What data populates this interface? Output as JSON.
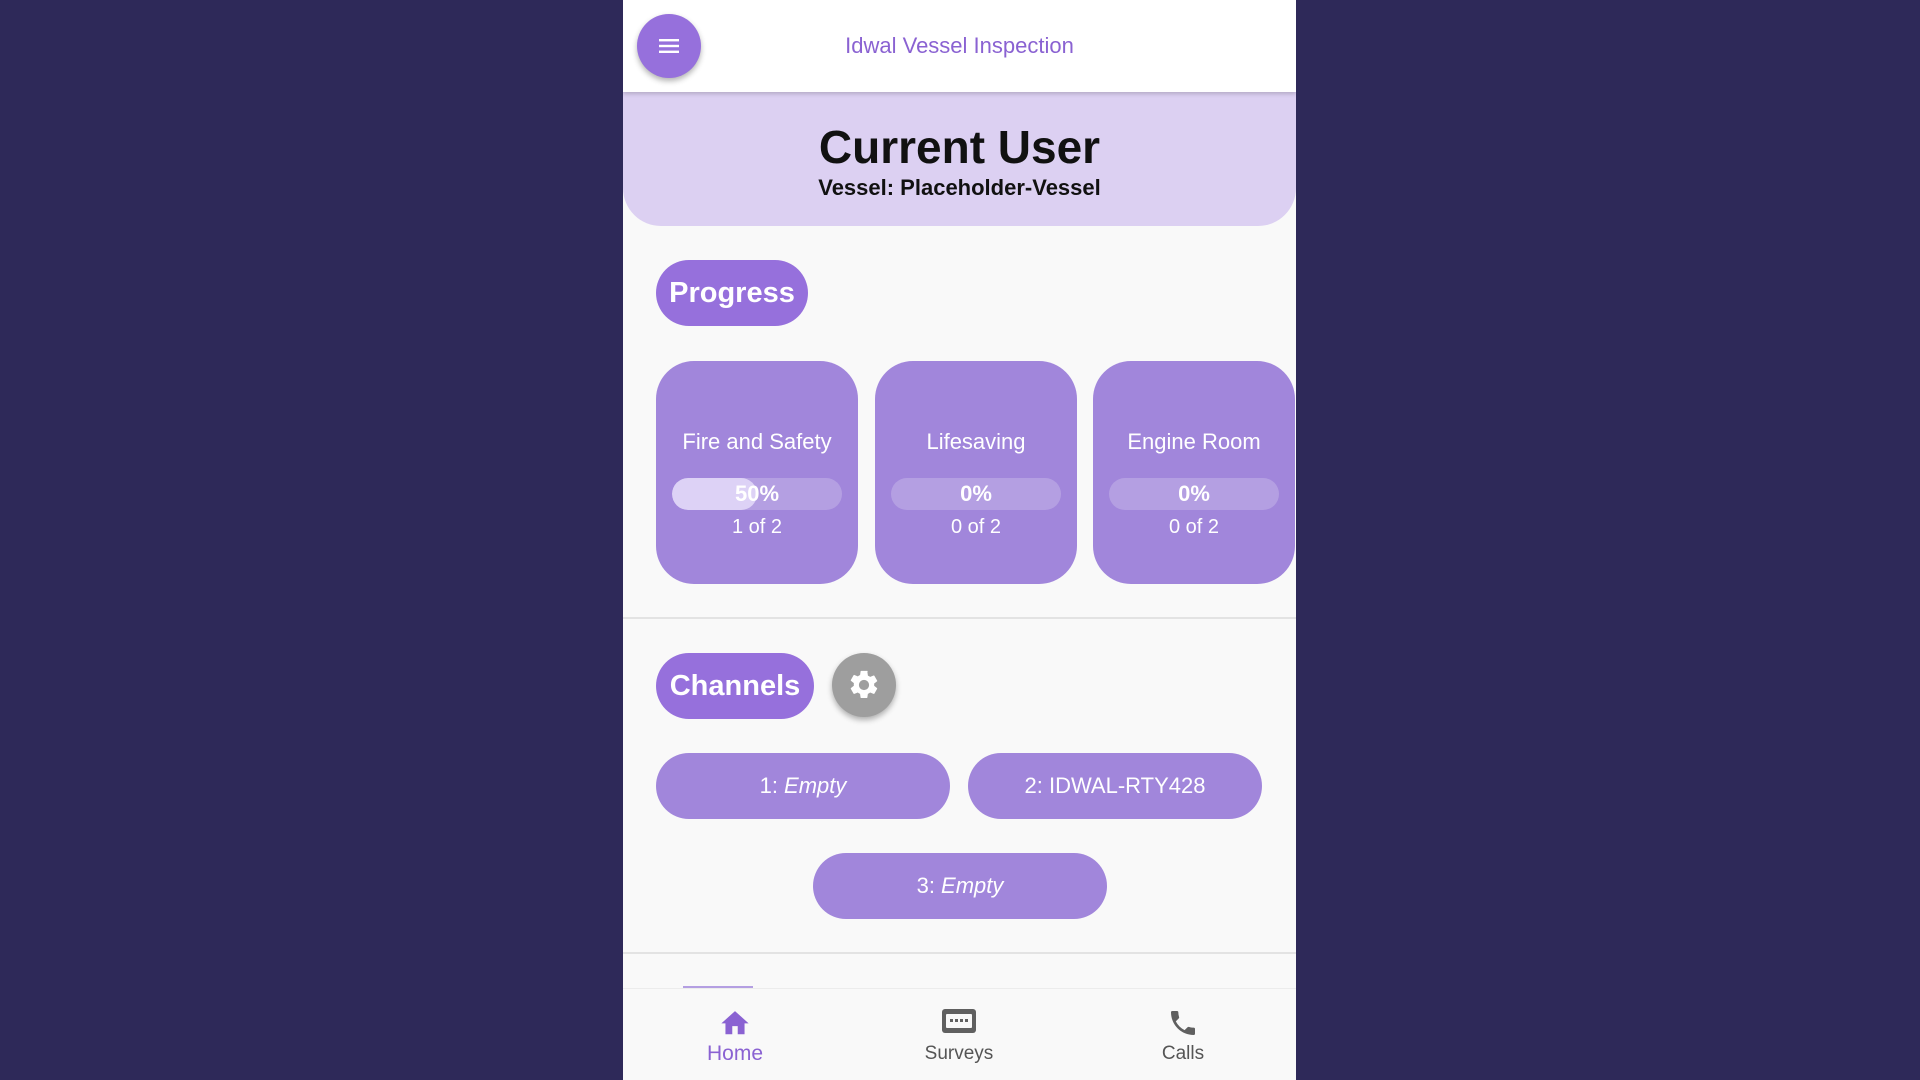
{
  "app": {
    "title": "Idwal Vessel Inspection"
  },
  "header": {
    "user": "Current User",
    "vessel": "Vessel: Placeholder-Vessel"
  },
  "progress": {
    "title": "Progress",
    "cards": [
      {
        "name": "Fire and Safety",
        "percent_text": "50%",
        "fraction": 0.5,
        "count_text": "1 of 2"
      },
      {
        "name": "Lifesaving",
        "percent_text": "0%",
        "fraction": 0.0,
        "count_text": "0 of 2"
      },
      {
        "name": "Engine Room",
        "percent_text": "0%",
        "fraction": 0.0,
        "count_text": "0 of 2"
      }
    ]
  },
  "channels": {
    "title": "Channels",
    "settings_icon": "gear-icon",
    "items": [
      {
        "prefix": "1: ",
        "value": "Empty"
      },
      {
        "prefix": "2: ",
        "value": "IDWAL-RTY428"
      },
      {
        "prefix": "3: ",
        "value": "Empty"
      }
    ]
  },
  "nav": {
    "items": [
      {
        "label": "Home",
        "icon": "home-icon",
        "active": true
      },
      {
        "label": "Surveys",
        "icon": "keyboard-icon",
        "active": false
      },
      {
        "label": "Calls",
        "icon": "phone-icon",
        "active": false
      }
    ]
  },
  "colors": {
    "background": "#2e2959",
    "accent": "#9670dc",
    "card": "#a186db",
    "header_bg": "#dcd0f2"
  }
}
